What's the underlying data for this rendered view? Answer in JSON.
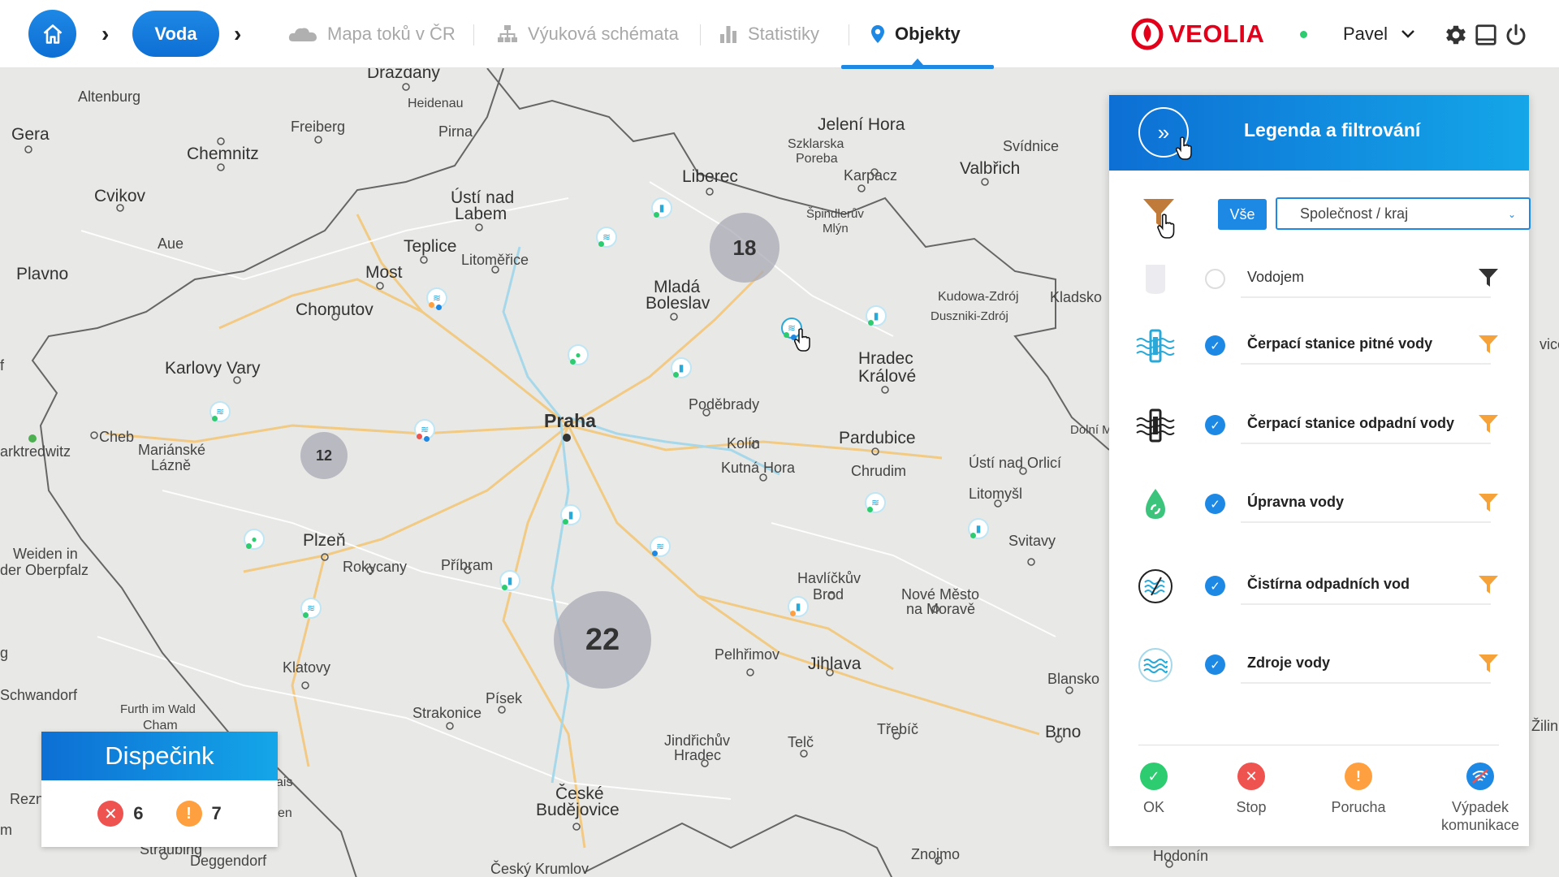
{
  "topbar": {
    "breadcrumb_active": "Voda",
    "nav": [
      {
        "label": "Mapa toků v ČR"
      },
      {
        "label": "Výuková schémata"
      },
      {
        "label": "Statistiky"
      },
      {
        "label": "Objekty"
      }
    ],
    "logo_text": "VEOLIA",
    "user": "Pavel"
  },
  "map": {
    "places": [
      {
        "label": "Drazdany"
      },
      {
        "label": "Altenburg"
      },
      {
        "label": "Heidenau"
      },
      {
        "label": "Gera"
      },
      {
        "label": "Freiberg"
      },
      {
        "label": "Pirna"
      },
      {
        "label": "Chemnitz"
      },
      {
        "label": "Jelení Hora"
      },
      {
        "label": "Szklarska"
      },
      {
        "label": "Poreba"
      },
      {
        "label": "Svídnice"
      },
      {
        "label": "Karpacz"
      },
      {
        "label": "Valbřich"
      },
      {
        "label": "Liberec"
      },
      {
        "label": "Cvikov"
      },
      {
        "label": "Ústí nad"
      },
      {
        "label": "Labem"
      },
      {
        "label": "Špindlerův"
      },
      {
        "label": "Mlýn"
      },
      {
        "label": "Aue"
      },
      {
        "label": "Teplice"
      },
      {
        "label": "Plavno"
      },
      {
        "label": "Most"
      },
      {
        "label": "Litoměřice"
      },
      {
        "label": "Mladá"
      },
      {
        "label": "Boleslav"
      },
      {
        "label": "Kudowa-Zdrój"
      },
      {
        "label": "Kladsko"
      },
      {
        "label": "Chomutov"
      },
      {
        "label": "Duszniki-Zdrój"
      },
      {
        "label": "Hradec"
      },
      {
        "label": "Králové"
      },
      {
        "label": "Karlovy Vary"
      },
      {
        "label": "Poděbrady"
      },
      {
        "label": "Praha"
      },
      {
        "label": "Cheb"
      },
      {
        "label": "arktredwitz"
      },
      {
        "label": "Mariánské"
      },
      {
        "label": "Lázně"
      },
      {
        "label": "Kolín"
      },
      {
        "label": "Pardubice"
      },
      {
        "label": "Dolní M"
      },
      {
        "label": "Kutná Hora"
      },
      {
        "label": "Ústí nad Orlicí"
      },
      {
        "label": "Chrudim"
      },
      {
        "label": "Litomyšl"
      },
      {
        "label": "Weiden in"
      },
      {
        "label": "der Oberpfalz"
      },
      {
        "label": "Plzeň"
      },
      {
        "label": "Svitavy"
      },
      {
        "label": "Rokycany"
      },
      {
        "label": "Příbram"
      },
      {
        "label": "Havlíčkův"
      },
      {
        "label": "Brod"
      },
      {
        "label": "Nové Město"
      },
      {
        "label": "na Moravě"
      },
      {
        "label": "Schwandorf"
      },
      {
        "label": "Klatovy"
      },
      {
        "label": "Pelhřimov"
      },
      {
        "label": "Jihlava"
      },
      {
        "label": "Furth im Wald"
      },
      {
        "label": "Cham"
      },
      {
        "label": "Písek"
      },
      {
        "label": "Blansko"
      },
      {
        "label": "Strakonice"
      },
      {
        "label": "Třebíč"
      },
      {
        "label": "Brno"
      },
      {
        "label": "Jindřichův"
      },
      {
        "label": "Hradec"
      },
      {
        "label": "Telč"
      },
      {
        "label": "Rezn"
      },
      {
        "label": "České"
      },
      {
        "label": "Budějovice"
      },
      {
        "label": "Straubing"
      },
      {
        "label": "Deggendorf"
      },
      {
        "label": "Znojmo"
      },
      {
        "label": "Hodonín"
      },
      {
        "label": "Český Krumlov"
      },
      {
        "label": "vice"
      },
      {
        "label": "Žilin"
      },
      {
        "label": "ais"
      },
      {
        "label": "en"
      },
      {
        "label": "m"
      },
      {
        "label": "g"
      },
      {
        "label": "f"
      }
    ],
    "clusters": [
      {
        "count": "18"
      },
      {
        "count": "12"
      },
      {
        "count": "22"
      }
    ]
  },
  "dispatch": {
    "title": "Dispečink",
    "stop_count": "6",
    "fault_count": "7"
  },
  "legend": {
    "title": "Legenda a filtrování",
    "all_label": "Vše",
    "select_value": "Společnost / kraj",
    "items": [
      {
        "label": "Vodojem",
        "checked": false
      },
      {
        "label": "Čerpací stanice pitné vody",
        "checked": true
      },
      {
        "label": "Čerpací stanice odpadní vody",
        "checked": true
      },
      {
        "label": "Úpravna vody",
        "checked": true
      },
      {
        "label": "Čistírna odpadních vod",
        "checked": true
      },
      {
        "label": "Zdroje vody",
        "checked": true
      }
    ],
    "statuses": [
      {
        "label": "OK",
        "color": "#2ecc71"
      },
      {
        "label": "Stop",
        "color": "#ef5350"
      },
      {
        "label": "Porucha",
        "color": "#ffa040"
      },
      {
        "label": "Výpadek komunikace",
        "color": "#1e88e5"
      }
    ]
  },
  "colors": {
    "accent": "#1e88e5",
    "brand": "#e2001a",
    "funnel_orange": "#f5a23a"
  }
}
